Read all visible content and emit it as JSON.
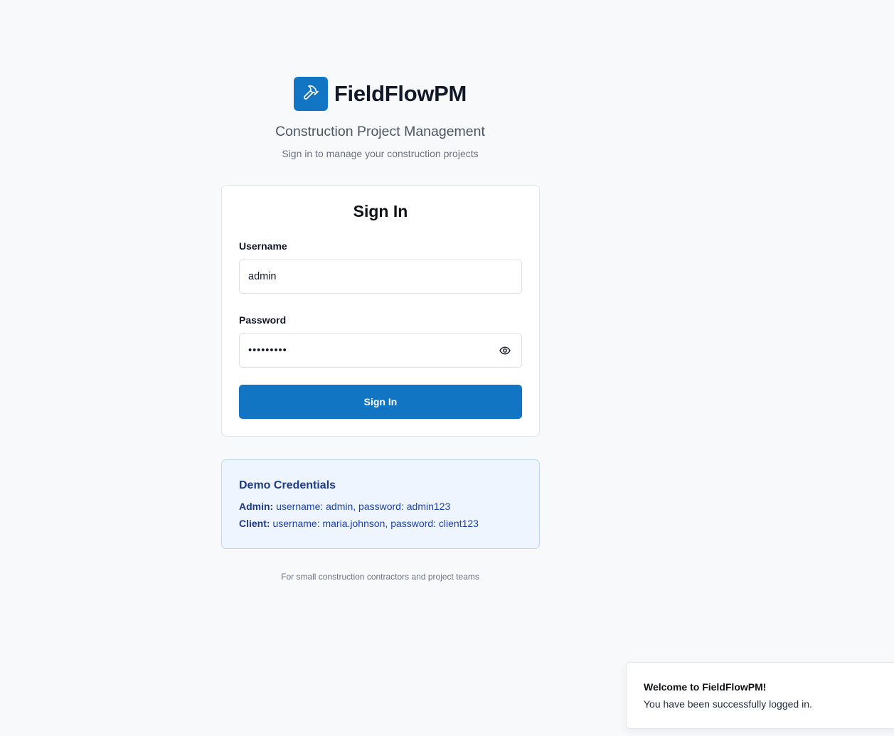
{
  "brand": {
    "name": "FieldFlowPM",
    "logo_icon": "hammer-icon",
    "accent_color": "#1275c4"
  },
  "header": {
    "subtitle": "Construction Project Management",
    "tagline": "Sign in to manage your construction projects"
  },
  "signin": {
    "title": "Sign In",
    "username_label": "Username",
    "username_value": "admin",
    "password_label": "Password",
    "password_value": "admin1234",
    "password_toggle_icon": "eye-icon",
    "submit_label": "Sign In"
  },
  "demo": {
    "title": "Demo Credentials",
    "admin_label": "Admin:",
    "admin_text": "username: admin, password: admin123",
    "client_label": "Client:",
    "client_text": "username: maria.johnson, password: client123"
  },
  "footer": {
    "note": "For small construction contractors and project teams"
  },
  "toast": {
    "title": "Welcome to FieldFlowPM!",
    "message": "You have been successfully logged in."
  }
}
